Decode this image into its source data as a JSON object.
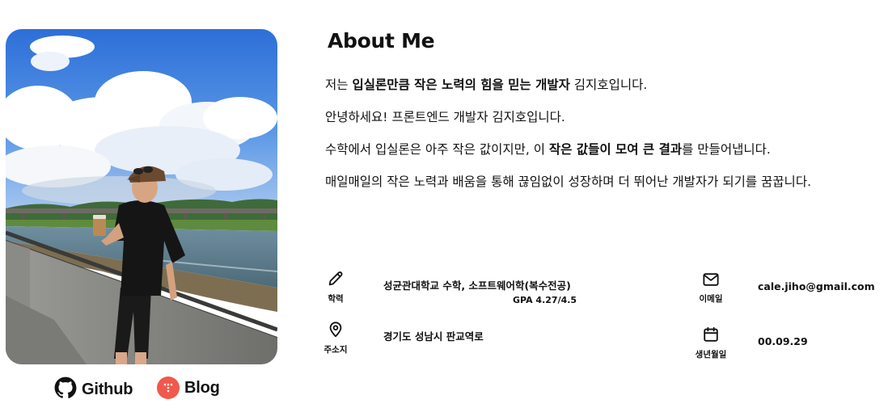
{
  "profile": {
    "photo_icon": "profile-photo"
  },
  "links": {
    "github": {
      "label": "Github",
      "icon": "github-icon"
    },
    "blog": {
      "label": "Blog",
      "icon": "blog-icon",
      "color": "#f0594b"
    }
  },
  "about": {
    "title": "About Me",
    "paragraphs": {
      "p1": {
        "prefix": "저는 ",
        "bold": "입실론만큼 작은 노력의 힘을 믿는 개발자",
        "suffix": " 김지호입니다."
      },
      "p2": {
        "text": "안녕하세요! 프론트엔드 개발자 김지호입니다."
      },
      "p3": {
        "prefix": "수학에서 입실론은 아주 작은 값이지만, 이 ",
        "bold": "작은 값들이 모여 큰 결과",
        "suffix": "를 만들어냅니다."
      },
      "p4": {
        "text": "매일매일의 작은 노력과 배움을 통해 끊임없이 성장하며 더 뛰어난 개발자가 되기를 꿈꿉니다."
      }
    }
  },
  "info": {
    "education": {
      "caption": "학력",
      "value": "성균관대학교 수학, 소프트웨어학(복수전공)",
      "gpa": "GPA 4.27/4.5",
      "icon": "pencil-icon"
    },
    "email": {
      "caption": "이메일",
      "value": "cale.jiho@gmail.com",
      "icon": "mail-icon"
    },
    "address": {
      "caption": "주소지",
      "value": "경기도 성남시 판교역로",
      "icon": "location-pin-icon"
    },
    "birthday": {
      "caption": "생년월일",
      "value": "00.09.29",
      "icon": "calendar-icon"
    }
  }
}
